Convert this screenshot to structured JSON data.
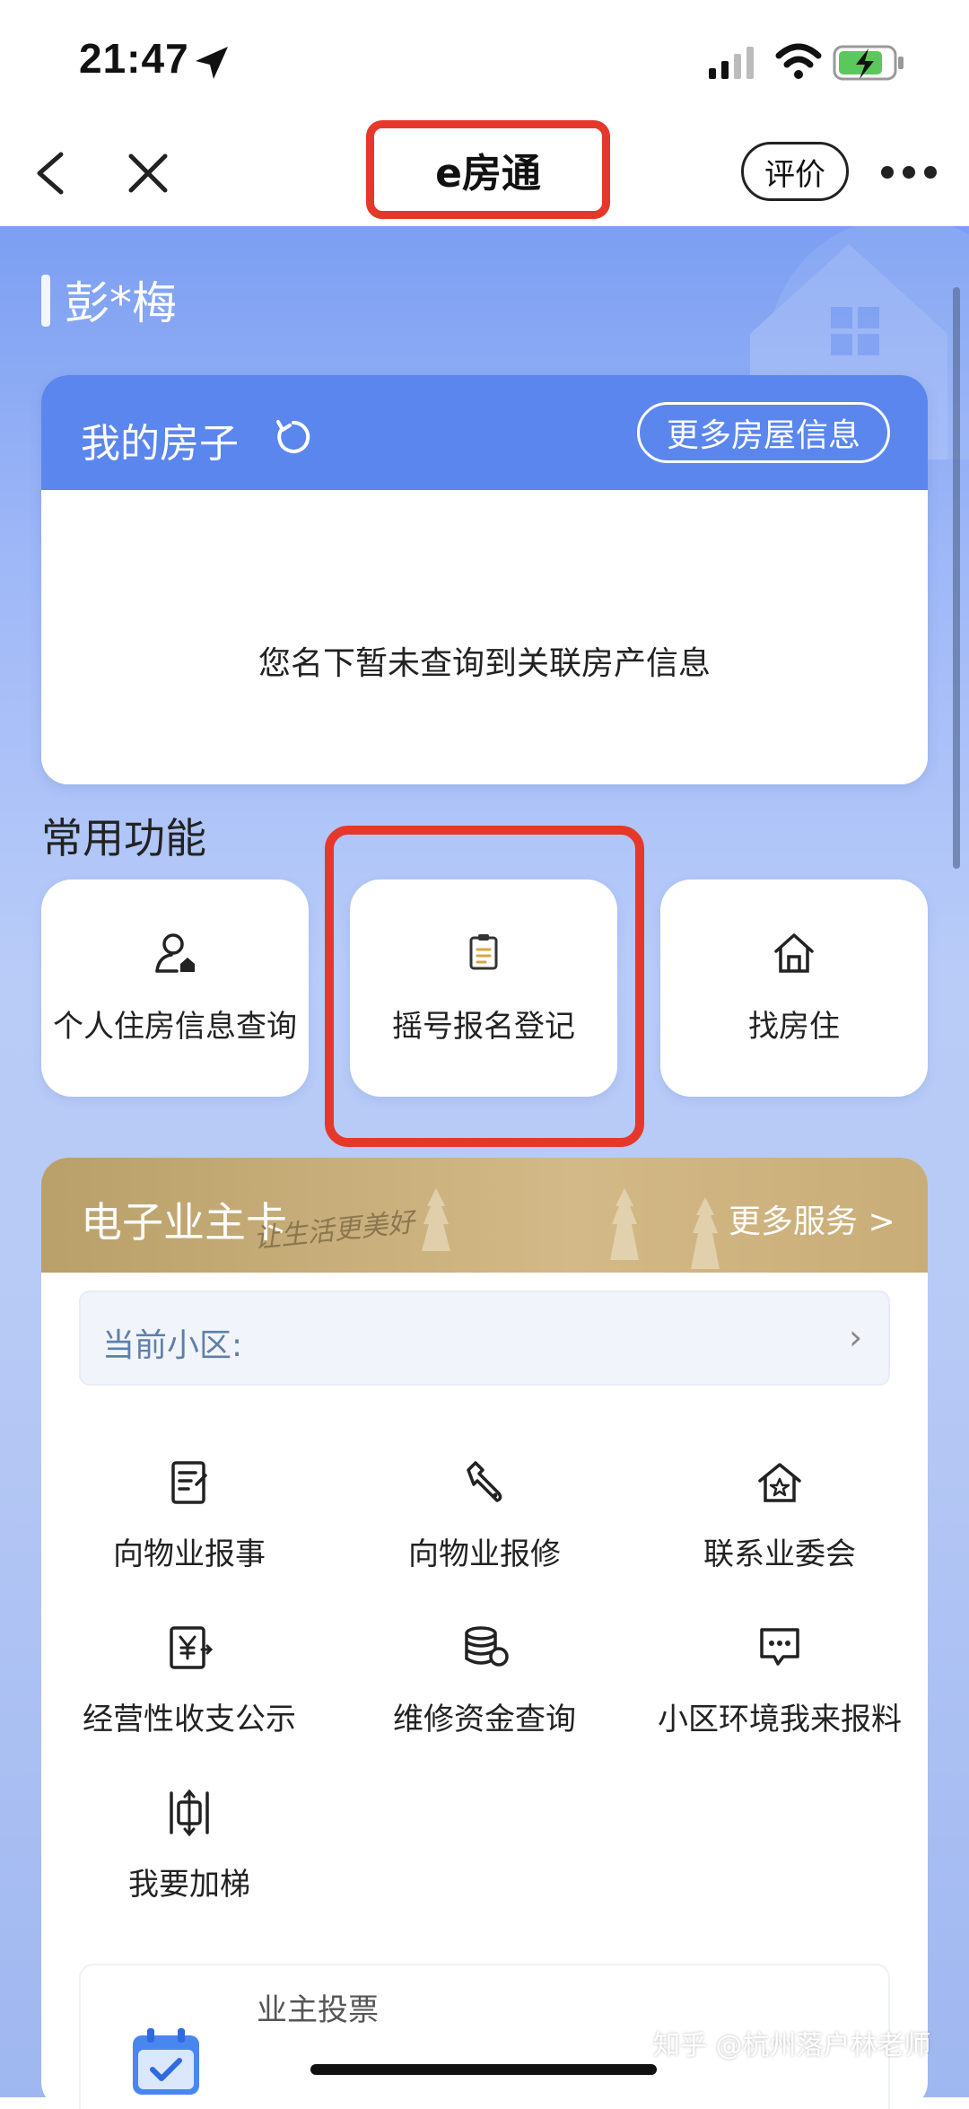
{
  "status_bar": {
    "time": "21:47"
  },
  "nav": {
    "title": "e房通",
    "rate_label": "评价"
  },
  "user": {
    "name": "彭*梅"
  },
  "house_card": {
    "title": "我的房子",
    "more_label": "更多房屋信息",
    "empty_text": "您名下暂未查询到关联房产信息"
  },
  "common": {
    "title": "常用功能",
    "items": [
      {
        "label": "个人住房信息查询",
        "icon": "person-house-icon"
      },
      {
        "label": "摇号报名登记",
        "icon": "clipboard-icon"
      },
      {
        "label": "找房住",
        "icon": "house-icon"
      }
    ]
  },
  "owner_card": {
    "title": "电子业主卡",
    "script_text": "让生活更美好",
    "more_label": "更多服务 >",
    "community_label": "当前小区:",
    "services": [
      {
        "label": "向物业报事",
        "icon": "report-document-icon"
      },
      {
        "label": "向物业报修",
        "icon": "wrench-icon"
      },
      {
        "label": "联系业委会",
        "icon": "star-house-icon"
      },
      {
        "label": "经营性收支公示",
        "icon": "yuan-document-icon"
      },
      {
        "label": "维修资金查询",
        "icon": "coins-icon"
      },
      {
        "label": "小区环境我来报料",
        "icon": "chat-bubble-icon"
      },
      {
        "label": "我要加梯",
        "icon": "elevator-icon"
      }
    ],
    "vote_title": "业主投票"
  },
  "watermark": "知乎 @杭州落户林老师",
  "colors": {
    "highlight": "#e5382b",
    "house_header": "#5a86ee",
    "owner_header": "#c9ad78"
  }
}
